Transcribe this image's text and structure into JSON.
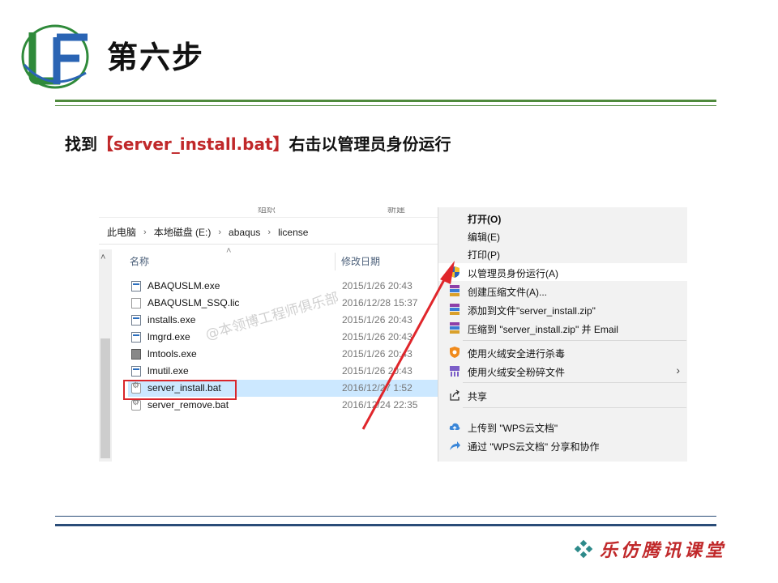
{
  "slide": {
    "title": "第六步",
    "instruction_pre": "找到",
    "instruction_highlight": "【server_install.bat】",
    "instruction_post": "右击以管理员身份运行",
    "brand": "乐仿腾讯课堂",
    "watermark": "@本领博工程师俱乐部",
    "colors": {
      "accent_green": "#4f8a3c",
      "highlight_red": "#c0282a",
      "rule_blue": "#2a4c78"
    }
  },
  "explorer": {
    "ribbon_fragments": [
      "组织",
      "新建"
    ],
    "breadcrumb": [
      "此电脑",
      "本地磁盘 (E:)",
      "abaqus",
      "license"
    ],
    "columns": {
      "name": "名称",
      "modified": "修改日期"
    },
    "files": [
      {
        "name": "ABAQUSLM.exe",
        "date": "2015/1/26 20:43",
        "icon": "exe-icon"
      },
      {
        "name": "ABAQUSLM_SSQ.lic",
        "date": "2016/12/28 15:37",
        "icon": "license-file-icon"
      },
      {
        "name": "installs.exe",
        "date": "2015/1/26 20:43",
        "icon": "exe-icon"
      },
      {
        "name": "lmgrd.exe",
        "date": "2015/1/26 20:43",
        "icon": "exe-icon"
      },
      {
        "name": "lmtools.exe",
        "date": "2015/1/26 20:43",
        "icon": "tool-exe-icon"
      },
      {
        "name": "lmutil.exe",
        "date": "2015/1/26 20:43",
        "icon": "exe-icon"
      },
      {
        "name": "server_install.bat",
        "date": "2016/12/27 1:52",
        "icon": "batch-file-icon",
        "selected": true
      },
      {
        "name": "server_remove.bat",
        "date": "2016/12/24 22:35",
        "icon": "batch-file-icon"
      }
    ]
  },
  "context_menu": {
    "open": "打开(O)",
    "edit": "编辑(E)",
    "print": "打印(P)",
    "run_as_admin": "以管理员身份运行(A)",
    "create_archive": "创建压缩文件(A)...",
    "add_to_zip": "添加到文件\"server_install.zip\"",
    "zip_and_email": "压缩到 \"server_install.zip\" 并 Email",
    "scan_virus": "使用火绒安全进行杀毒",
    "shred_file": "使用火绒安全粉碎文件",
    "share": "共享",
    "upload_wps": "上传到 \"WPS云文档\"",
    "share_wps": "通过 \"WPS云文档\" 分享和协作"
  }
}
